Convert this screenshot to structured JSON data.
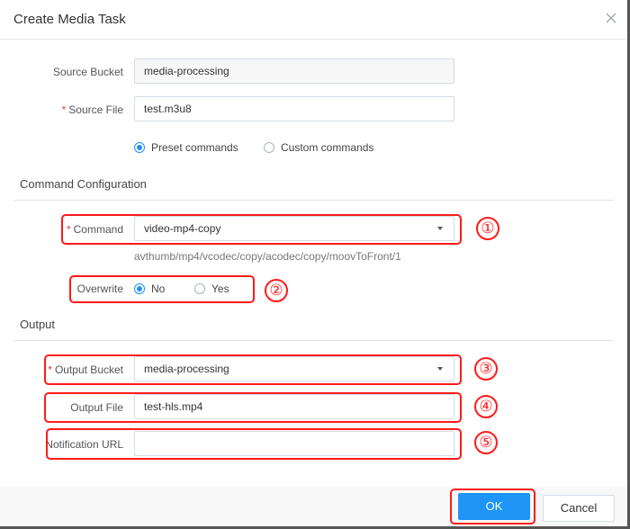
{
  "dialog": {
    "title": "Create Media Task",
    "close_icon": "close-icon"
  },
  "source": {
    "bucket_label": "Source Bucket",
    "bucket_value": "media-processing",
    "file_label": "Source File",
    "file_value": "test.m3u8",
    "required_mark": "*",
    "command_type_options": [
      {
        "label": "Preset commands",
        "selected": true
      },
      {
        "label": "Custom commands",
        "selected": false
      }
    ]
  },
  "command_config": {
    "section_title": "Command Configuration",
    "command_label": "Command",
    "command_value": "video-mp4-copy",
    "command_hint": "avthumb/mp4/vcodec/copy/acodec/copy/moovToFront/1",
    "overwrite_label": "Overwrite",
    "overwrite_options": [
      {
        "label": "No",
        "selected": true
      },
      {
        "label": "Yes",
        "selected": false
      }
    ]
  },
  "output": {
    "section_title": "Output",
    "bucket_label": "Output Bucket",
    "bucket_value": "media-processing",
    "file_label": "Output File",
    "file_value": "test-hls.mp4",
    "notification_label": "Notification URL",
    "notification_value": ""
  },
  "annotations": {
    "markers": [
      "①",
      "②",
      "③",
      "④",
      "⑤"
    ],
    "color": "#ff1a1a"
  },
  "footer": {
    "ok_label": "OK",
    "cancel_label": "Cancel"
  },
  "colors": {
    "primary": "#1e95f7",
    "required": "#e4393c"
  }
}
